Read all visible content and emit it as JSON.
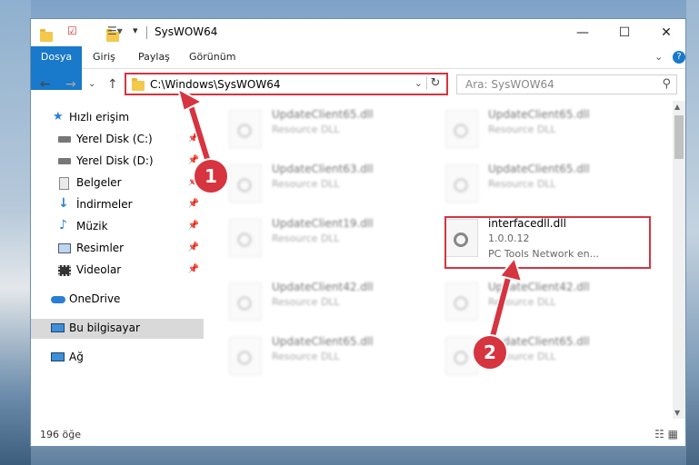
{
  "window": {
    "title": "SysWOW64",
    "controls": {
      "minimize": "—",
      "maximize": "☐",
      "close": "✕"
    }
  },
  "ribbon": {
    "tabs": [
      "Dosya",
      "Giriş",
      "Paylaş",
      "Görünüm"
    ],
    "collapse_icon": "⌄",
    "help_label": "?"
  },
  "address": {
    "path": "C:\\Windows\\SysWOW64",
    "dropdown": "⌄",
    "refresh": "↻"
  },
  "search": {
    "placeholder": "Ara: SysWOW64",
    "icon": "⚲"
  },
  "nav": {
    "back": "←",
    "forward": "→",
    "recent": "⌄",
    "up": "↑",
    "items": [
      {
        "label": "Hızlı erişim",
        "icon": "star-icon"
      },
      {
        "label": "Yerel Disk (C:)",
        "icon": "drive-icon",
        "pinned": true
      },
      {
        "label": "Yerel Disk (D:)",
        "icon": "drive-icon",
        "pinned": true
      },
      {
        "label": "Belgeler",
        "icon": "document-icon",
        "pinned": true
      },
      {
        "label": "İndirmeler",
        "icon": "download-icon",
        "pinned": true
      },
      {
        "label": "Müzik",
        "icon": "music-icon",
        "pinned": true
      },
      {
        "label": "Resimler",
        "icon": "picture-icon",
        "pinned": true
      },
      {
        "label": "Videolar",
        "icon": "video-icon",
        "pinned": true
      },
      {
        "label": "OneDrive",
        "icon": "cloud-icon"
      },
      {
        "label": "Bu bilgisayar",
        "icon": "computer-icon",
        "selected": true
      },
      {
        "label": "Ağ",
        "icon": "network-icon"
      }
    ]
  },
  "files": [
    {
      "name": "UpdateClient65.dll",
      "desc": "Resource DLL"
    },
    {
      "name": "UpdateClient65.dll",
      "desc": "Resource DLL"
    },
    {
      "name": "UpdateClient63.dll",
      "desc": "Resource DLL"
    },
    {
      "name": "UpdateClient65.dll",
      "desc": "Resource DLL"
    },
    {
      "name": "UpdateClient19.dll",
      "desc": "Resource DLL"
    },
    {
      "name": "interfacedll.dll",
      "desc": "1.0.0.12",
      "desc2": "PC Tools Network en...",
      "highlighted": true
    },
    {
      "name": "UpdateClient42.dll",
      "desc": "Resource DLL"
    },
    {
      "name": "UpdateClient42.dll",
      "desc": "Resource DLL"
    },
    {
      "name": "UpdateClient65.dll",
      "desc": "Resource DLL"
    },
    {
      "name": "UpdateClient65.dll",
      "desc": "Resource DLL"
    }
  ],
  "status": {
    "count": "196 öğe",
    "views": "☷ ▦"
  },
  "callouts": {
    "one": "1",
    "two": "2"
  },
  "colors": {
    "accent": "#1979ca",
    "callout": "#d6343f"
  }
}
